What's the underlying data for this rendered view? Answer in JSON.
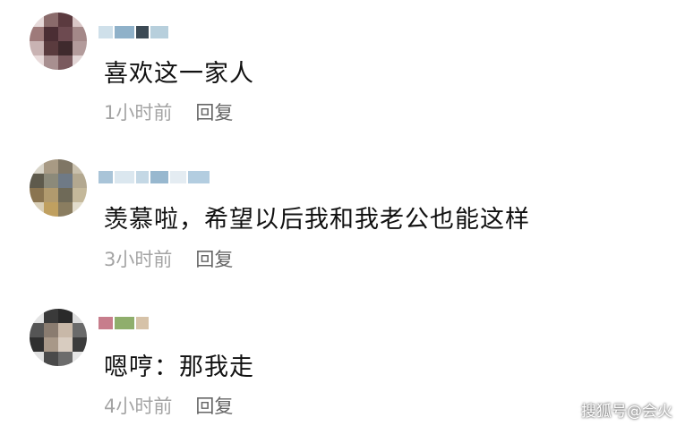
{
  "comments": [
    {
      "text": "喜欢这一家人",
      "time": "1小时前",
      "reply": "回复",
      "avatar_colors": [
        "#e6d9d9",
        "#8a6b6b",
        "#5b3a3f",
        "#d9c6c6",
        "#9e7a7a",
        "#4b2e34",
        "#6d4a50",
        "#a48888",
        "#c9b3b3",
        "#5a3b3e",
        "#3f2a2d",
        "#b39b9b",
        "#e8dada",
        "#a88f90",
        "#7a5a5e",
        "#e2d5d5"
      ],
      "name_colors": [
        "#cfe0ea",
        "#8fb1c9",
        "#3c4a55",
        "#b7cfdc"
      ]
    },
    {
      "text": "羡慕啦，希望以后我和我老公也能这样",
      "time": "3小时前",
      "reply": "回复",
      "avatar_colors": [
        "#d8d4c8",
        "#a89a84",
        "#7f7665",
        "#c9c0ad",
        "#5e5a4c",
        "#8c8a7a",
        "#6f7a86",
        "#b3a890",
        "#8a7450",
        "#b19a6e",
        "#6f6a58",
        "#c4b89a",
        "#d9cfb8",
        "#c0a060",
        "#8a7d60",
        "#e2dccb"
      ],
      "name_colors": [
        "#a9c4d8",
        "#dbe7ef",
        "#c4d8e5",
        "#98b8cf",
        "#e4ecf2",
        "#b3cde0"
      ]
    },
    {
      "text": "嗯哼：那我走",
      "time": "4小时前",
      "reply": "回复",
      "avatar_colors": [
        "#e3e3e3",
        "#3a3a3a",
        "#2a2a2a",
        "#dcdcdc",
        "#555555",
        "#8a7c70",
        "#c8b8a8",
        "#6a6a6a",
        "#2f2f2f",
        "#a89888",
        "#d8ccc0",
        "#3c3c3c",
        "#e0e0e0",
        "#4a4a4a",
        "#6c6c6c",
        "#e6e6e6"
      ],
      "name_colors": [
        "#c77d8c",
        "#8fae6c",
        "#d6c2a8"
      ]
    }
  ],
  "watermark": "搜狐号@会火"
}
